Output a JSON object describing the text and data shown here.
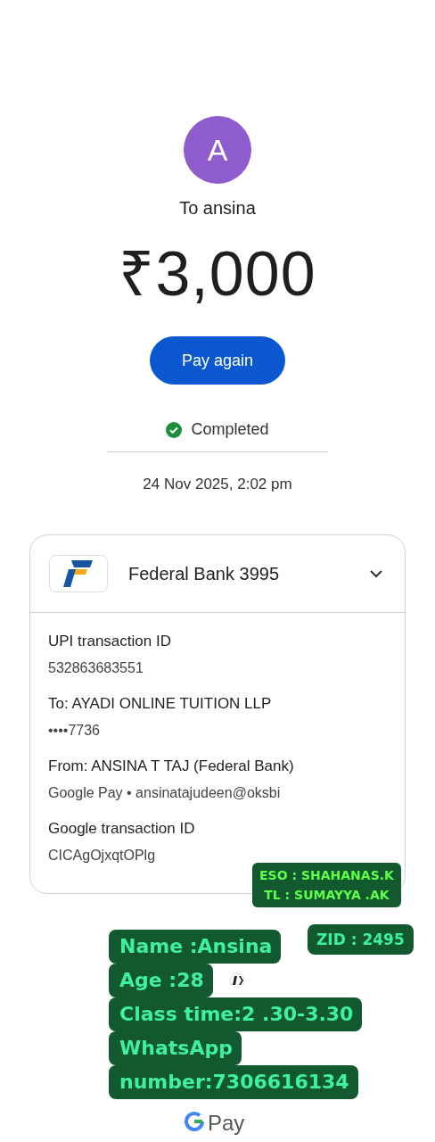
{
  "recipient": {
    "initial": "A",
    "label": "To ansina"
  },
  "amount": "₹3,000",
  "pay_again": "Pay again",
  "status": {
    "kind": "completed",
    "label": "Completed"
  },
  "date": "24 Nov 2025, 2:02 pm",
  "account_card": {
    "bank": "Federal Bank 3995",
    "details": [
      {
        "label": "UPI transaction ID",
        "value": "532863683551"
      },
      {
        "label": "To: AYADI ONLINE TUITION LLP",
        "value": "••••7736"
      },
      {
        "label": "From: ANSINA T TAJ (Federal Bank)",
        "value": "Google Pay • ansinatajudeen@oksbi"
      },
      {
        "label": "Google transaction ID",
        "value": "CICAgOjxqtOPlg"
      }
    ]
  },
  "footer": {
    "brand": "Pay"
  },
  "stickers": [
    {
      "kind": "small",
      "lines": [
        "ESO : SHAHANAS.K",
        "TL : SUMAYYA .AK"
      ]
    },
    {
      "kind": "tag",
      "lines": [
        "ZID : 2495"
      ]
    },
    {
      "kind": "large",
      "lines": [
        "Name :Ansina",
        "Age :28",
        "Class time:2 .30-3.30",
        "WhatsApp",
        "number:7306616134"
      ]
    }
  ]
}
